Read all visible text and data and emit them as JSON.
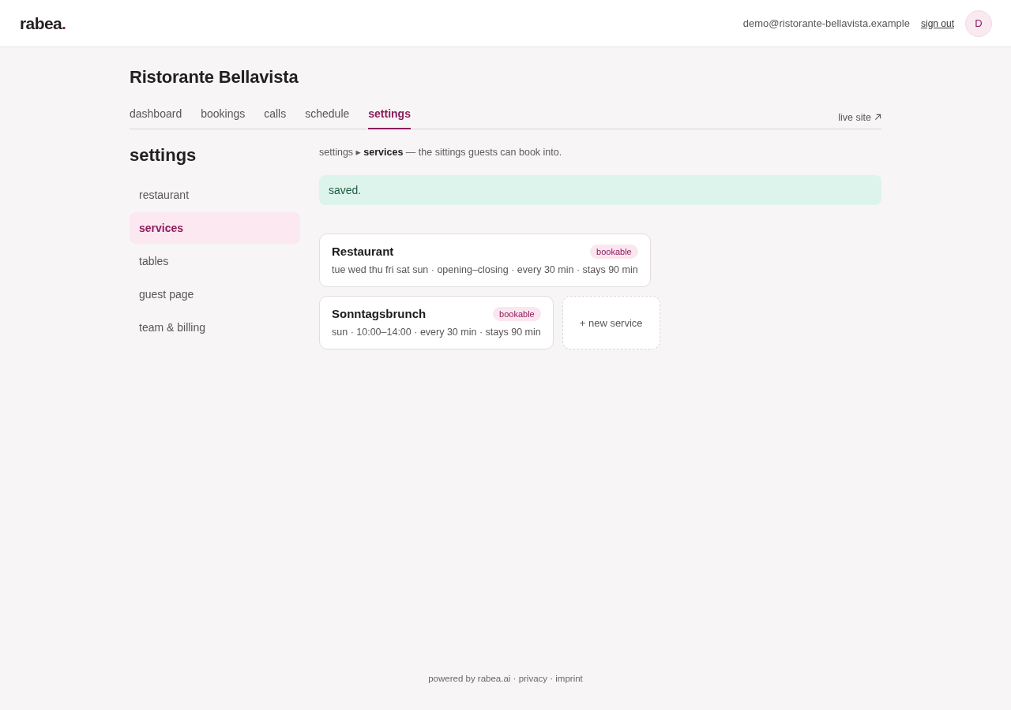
{
  "header": {
    "logo": {
      "word": "rabea",
      "dot": "."
    },
    "user_email": "demo@ristorante-bellavista.example",
    "sign_out": "sign out",
    "avatar_initial": "D"
  },
  "page_title": "Ristorante Bellavista",
  "tabs": [
    {
      "label": "dashboard",
      "selected": false
    },
    {
      "label": "bookings",
      "selected": false
    },
    {
      "label": "calls",
      "selected": false
    },
    {
      "label": "schedule",
      "selected": false
    },
    {
      "label": "settings",
      "selected": true
    }
  ],
  "live_site": "live site",
  "sidebar": {
    "title": "settings",
    "items": [
      {
        "label": "restaurant",
        "selected": false
      },
      {
        "label": "services",
        "selected": true
      },
      {
        "label": "tables",
        "selected": false
      },
      {
        "label": "guest page",
        "selected": false
      },
      {
        "label": "team & billing",
        "selected": false
      }
    ]
  },
  "breadcrumb": "settings ▸ **services** — the sittings guests can book into.",
  "alert": {
    "kind": "success",
    "text": "saved."
  },
  "services": [
    {
      "name": "Restaurant",
      "badge": "bookable",
      "summary": "tue wed thu fri sat sun · opening–closing · every 30 min · stays 90 min"
    },
    {
      "name": "Sonntagsbrunch",
      "badge": "bookable",
      "summary": "sun · 10:00–14:00 · every 30 min · stays 90 min"
    }
  ],
  "new_service": "+ new service",
  "footer": "powered by rabea.ai · privacy · imprint"
}
